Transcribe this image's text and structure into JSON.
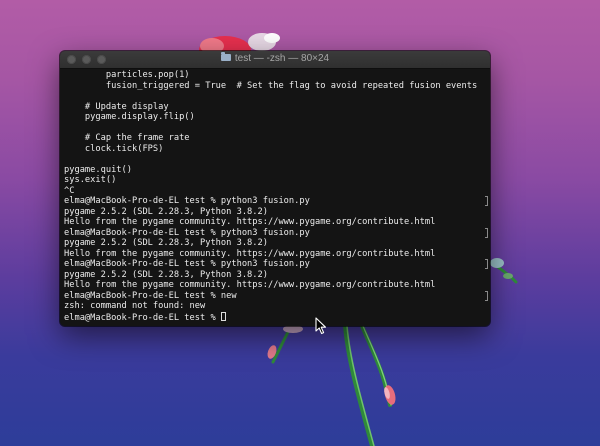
{
  "window": {
    "title": "test — -zsh — 80×24"
  },
  "terminal": {
    "lines": [
      "        particles.pop(1)",
      "        fusion_triggered = True  # Set the flag to avoid repeated fusion events",
      "",
      "    # Update display",
      "    pygame.display.flip()",
      "",
      "    # Cap the frame rate",
      "    clock.tick(FPS)",
      "",
      "pygame.quit()",
      "sys.exit()",
      "^C",
      "elma@MacBook-Pro-de-EL test % python3 fusion.py",
      "pygame 2.5.2 (SDL 2.28.3, Python 3.8.2)",
      "Hello from the pygame community. https://www.pygame.org/contribute.html",
      "elma@MacBook-Pro-de-EL test % python3 fusion.py",
      "pygame 2.5.2 (SDL 2.28.3, Python 3.8.2)",
      "Hello from the pygame community. https://www.pygame.org/contribute.html",
      "elma@MacBook-Pro-de-EL test % python3 fusion.py",
      "pygame 2.5.2 (SDL 2.28.3, Python 3.8.2)",
      "Hello from the pygame community. https://www.pygame.org/contribute.html",
      "elma@MacBook-Pro-de-EL test % new",
      "zsh: command not found: new"
    ],
    "prompt": "elma@MacBook-Pro-de-EL test % "
  },
  "icons": {
    "close": "close-button-icon",
    "minimize": "minimize-button-icon",
    "zoom": "zoom-button-icon",
    "folder": "folder-icon",
    "pointer": "mouse-pointer-icon"
  },
  "colors": {
    "terminal_bg": "#141414",
    "terminal_text": "#ececec",
    "titlebar": "#353535"
  }
}
